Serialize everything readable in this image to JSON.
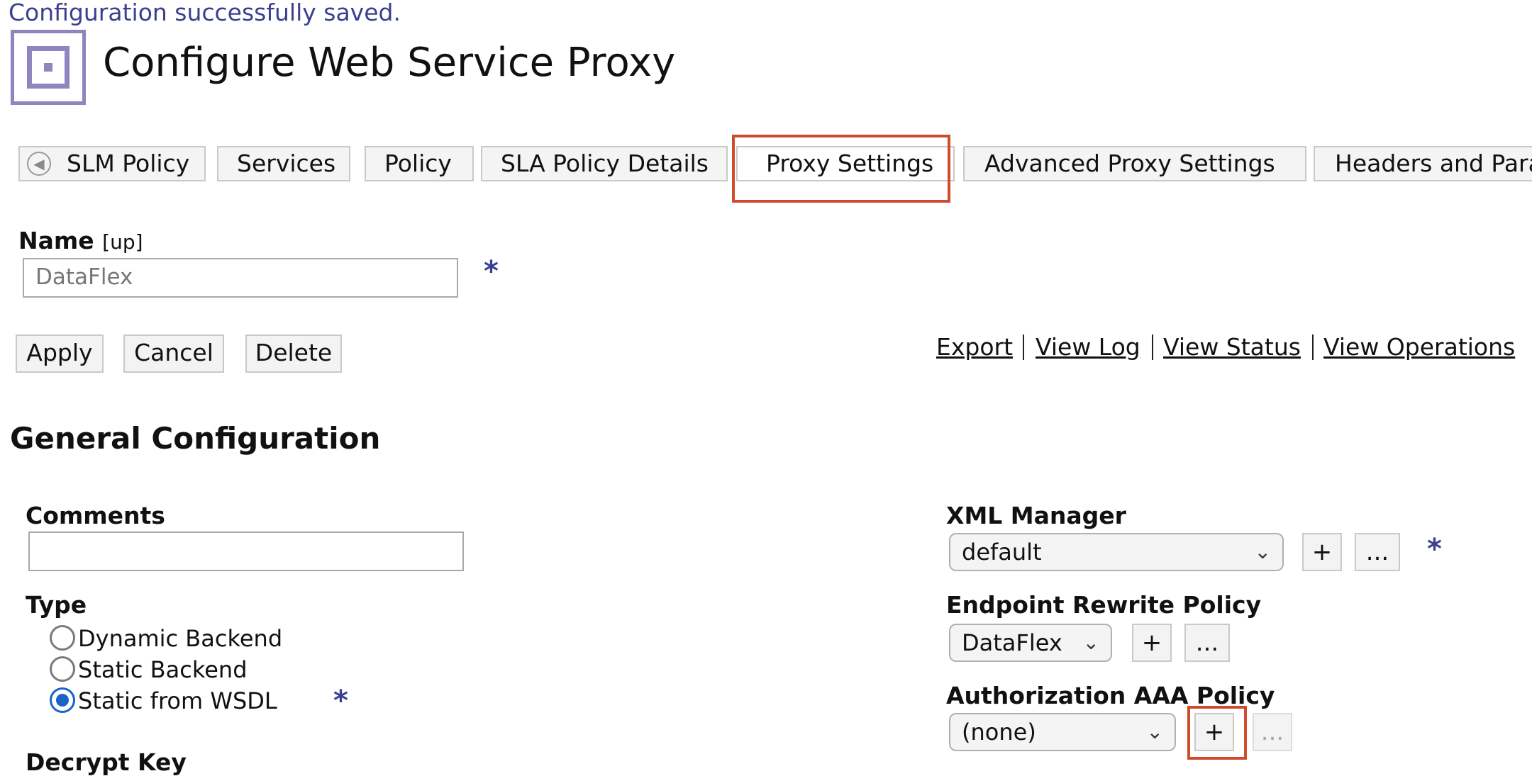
{
  "status_message": "Configuration successfully saved.",
  "page_title": "Configure Web Service Proxy",
  "tabs": [
    {
      "label": "SLM Policy"
    },
    {
      "label": "Services"
    },
    {
      "label": "Policy"
    },
    {
      "label": "SLA Policy Details"
    },
    {
      "label": "Proxy Settings"
    },
    {
      "label": "Advanced Proxy Settings"
    },
    {
      "label": "Headers and Para"
    }
  ],
  "name_section": {
    "label": "Name",
    "status": "[up]",
    "value": "DataFlex",
    "required": "*"
  },
  "actions": {
    "apply": "Apply",
    "cancel": "Cancel",
    "delete": "Delete"
  },
  "links": {
    "export": "Export",
    "view_log": "View Log",
    "view_status": "View Status",
    "view_operations": "View Operations"
  },
  "general": {
    "heading": "General Configuration",
    "comments_label": "Comments",
    "comments_value": "",
    "type_label": "Type",
    "type_options": [
      "Dynamic Backend",
      "Static Backend",
      "Static from WSDL"
    ],
    "type_selected": "Static from WSDL",
    "type_required": "*",
    "decrypt_label": "Decrypt Key"
  },
  "right": {
    "xml_manager_label": "XML Manager",
    "xml_manager_value": "default",
    "xml_required": "*",
    "endpoint_label": "Endpoint Rewrite Policy",
    "endpoint_value": "DataFlex",
    "aaa_label": "Authorization AAA Policy",
    "aaa_value": "(none)",
    "add_glyph": "+",
    "more_glyph": "..."
  },
  "colors": {
    "accent_highlight": "#cf4b2b",
    "message_text": "#3b3f8f",
    "radio_selected": "#1a64c8",
    "logo": "#8f86c0"
  }
}
